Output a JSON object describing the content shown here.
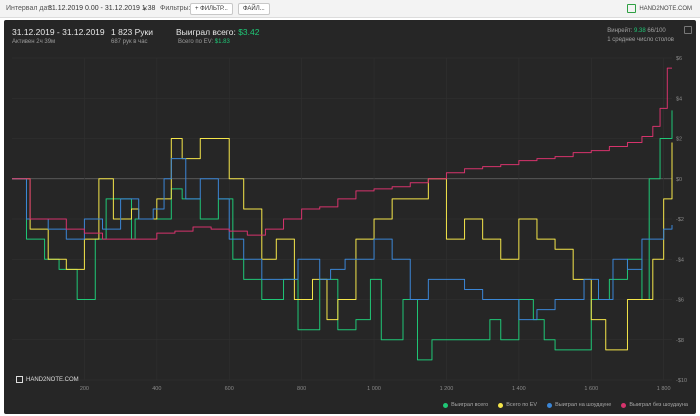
{
  "topbar": {
    "interval_label": "Интервал дат:",
    "interval_value": "31.12.2019 0.00 - 31.12.2019 1:38",
    "filters_label": "Фильтры:",
    "filter_button": "+ ФИЛЬТР...",
    "file_button": "ФАЙЛ...",
    "brand": "HAND2NOTE.COM"
  },
  "stats": {
    "date_range": "31.12.2019 - 31.12.2019",
    "active": "Активен 2ч 39м",
    "hands": "1 823 Руки",
    "hands_per_hour": "687 рук в час",
    "won_label": "Выиграл всего:",
    "won_value": "$3.42",
    "ev_label": "Всего по EV:",
    "ev_value": "$1.83",
    "winrate_label": "Винрейт:",
    "winrate_value": "9.38",
    "winrate_hands": "66/100",
    "tables": "1 среднее число столов"
  },
  "colors": {
    "won": "#1fc776",
    "ev": "#f5e64a",
    "showdown": "#3b86d6",
    "nonshowdown": "#d6336c"
  },
  "watermark": "HAND2NOTE.COM",
  "legend": {
    "won": "Выиграл всего",
    "ev": "Всего по EV",
    "showdown": "Выиграл на шоудауне",
    "nonshowdown": "Выиграл без шоудауна"
  },
  "chart_data": {
    "type": "line",
    "x_ticks": [
      "200",
      "400",
      "600",
      "800",
      "1 000",
      "1 200",
      "1 400",
      "1 600",
      "1 800"
    ],
    "y_ticks": [
      "$6",
      "$4",
      "$2",
      "$0",
      "-$2",
      "-$4",
      "-$6",
      "-$8",
      "-$10"
    ],
    "xlim": [
      0,
      1823
    ],
    "ylim": [
      -10,
      6
    ],
    "grid": true,
    "series": [
      {
        "name": "Выиграл всего",
        "key": "won",
        "x": [
          0,
          40,
          90,
          130,
          180,
          230,
          260,
          330,
          340,
          390,
          440,
          470,
          520,
          570,
          610,
          640,
          690,
          750,
          790,
          850,
          900,
          950,
          990,
          1020,
          1080,
          1120,
          1160,
          1200,
          1260,
          1320,
          1350,
          1400,
          1440,
          1470,
          1500,
          1560,
          1600,
          1650,
          1700,
          1740,
          1760,
          1790,
          1823
        ],
        "y": [
          0,
          -3,
          -4,
          -4.5,
          -6,
          -3,
          -1,
          -3,
          -2,
          -2,
          -0.5,
          -1,
          -2,
          -1,
          -4,
          -5,
          -6,
          -5,
          -7.5,
          -5,
          -7.5,
          -7,
          -5,
          -8,
          -6,
          -9,
          -8,
          -8,
          -8,
          -7,
          -8,
          -6,
          -7,
          -8,
          -8.5,
          -8.5,
          -6,
          -5,
          -4,
          -6,
          0,
          2,
          3.4
        ]
      },
      {
        "name": "Всего по EV",
        "key": "ev",
        "x": [
          0,
          50,
          100,
          150,
          200,
          240,
          280,
          330,
          350,
          400,
          440,
          470,
          520,
          570,
          600,
          640,
          690,
          730,
          780,
          830,
          870,
          900,
          950,
          1000,
          1050,
          1100,
          1150,
          1200,
          1250,
          1300,
          1350,
          1400,
          1450,
          1500,
          1550,
          1600,
          1640,
          1700,
          1740,
          1770,
          1800,
          1823
        ],
        "y": [
          0,
          -2.5,
          -4,
          -4.5,
          -3,
          0,
          -2,
          -1.5,
          -2,
          -1,
          2,
          1,
          2,
          2,
          0,
          -1.5,
          -4,
          -3,
          -6,
          -5,
          -7,
          -6,
          -3,
          -2,
          -1,
          -1,
          0,
          -3,
          -2,
          -3,
          -4,
          -2,
          -3,
          -3.5,
          -5,
          -7,
          -8.5,
          -6,
          -6,
          -4,
          -1,
          1.8
        ]
      },
      {
        "name": "Выиграл на шоудауне",
        "key": "showdown",
        "x": [
          0,
          40,
          100,
          150,
          200,
          250,
          300,
          350,
          390,
          420,
          440,
          480,
          520,
          570,
          600,
          640,
          690,
          740,
          790,
          850,
          880,
          920,
          960,
          1000,
          1050,
          1100,
          1150,
          1200,
          1250,
          1300,
          1350,
          1400,
          1450,
          1500,
          1540,
          1580,
          1620,
          1660,
          1700,
          1740,
          1770,
          1800,
          1823
        ],
        "y": [
          0,
          -2,
          -2.5,
          -3,
          -2,
          -2.5,
          -1,
          -2,
          -1.5,
          0,
          1,
          -1,
          0,
          -1,
          -3,
          -4,
          -5,
          -5,
          -4,
          -5,
          -4.5,
          -4,
          -4,
          -3,
          -4,
          -6,
          -5,
          -5,
          -5.5,
          -6,
          -6,
          -7,
          -6.5,
          -6,
          -6,
          -5,
          -6,
          -4,
          -4.5,
          -3,
          -3,
          -2.5,
          -2.3
        ]
      },
      {
        "name": "Выиграл без шоудауна",
        "key": "nonshowdown",
        "x": [
          0,
          50,
          100,
          150,
          200,
          250,
          300,
          350,
          400,
          450,
          500,
          550,
          600,
          650,
          700,
          750,
          800,
          850,
          900,
          950,
          1000,
          1050,
          1100,
          1150,
          1200,
          1250,
          1300,
          1350,
          1400,
          1450,
          1500,
          1550,
          1600,
          1650,
          1700,
          1740,
          1770,
          1790,
          1810,
          1823
        ],
        "y": [
          0,
          -2,
          -2,
          -2.5,
          -2.7,
          -3,
          -3,
          -3,
          -2.7,
          -2.6,
          -2.4,
          -2.5,
          -2.6,
          -2.8,
          -2.5,
          -2,
          -1.5,
          -1.4,
          -1,
          -0.6,
          -0.5,
          -0.4,
          -0.2,
          0,
          0.3,
          0.5,
          0.6,
          0.7,
          0.9,
          1,
          1.1,
          1.3,
          1.4,
          1.6,
          1.8,
          2.1,
          2.6,
          3.5,
          5.5,
          5.5
        ]
      }
    ]
  }
}
